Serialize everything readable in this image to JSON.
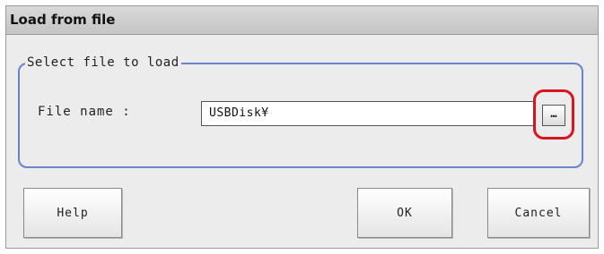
{
  "dialog": {
    "title": "Load from file",
    "group_label": "Select file to load",
    "file_name_label": "File name :",
    "file_name_value": "USBDisk¥",
    "browse_label": "…"
  },
  "buttons": {
    "help": "Help",
    "ok": "OK",
    "cancel": "Cancel"
  },
  "colors": {
    "group_border": "#6a84cc",
    "highlight_ring": "#d8141e",
    "dialog_bg": "#ececec"
  },
  "icons": {
    "browse": "ellipsis-icon"
  }
}
